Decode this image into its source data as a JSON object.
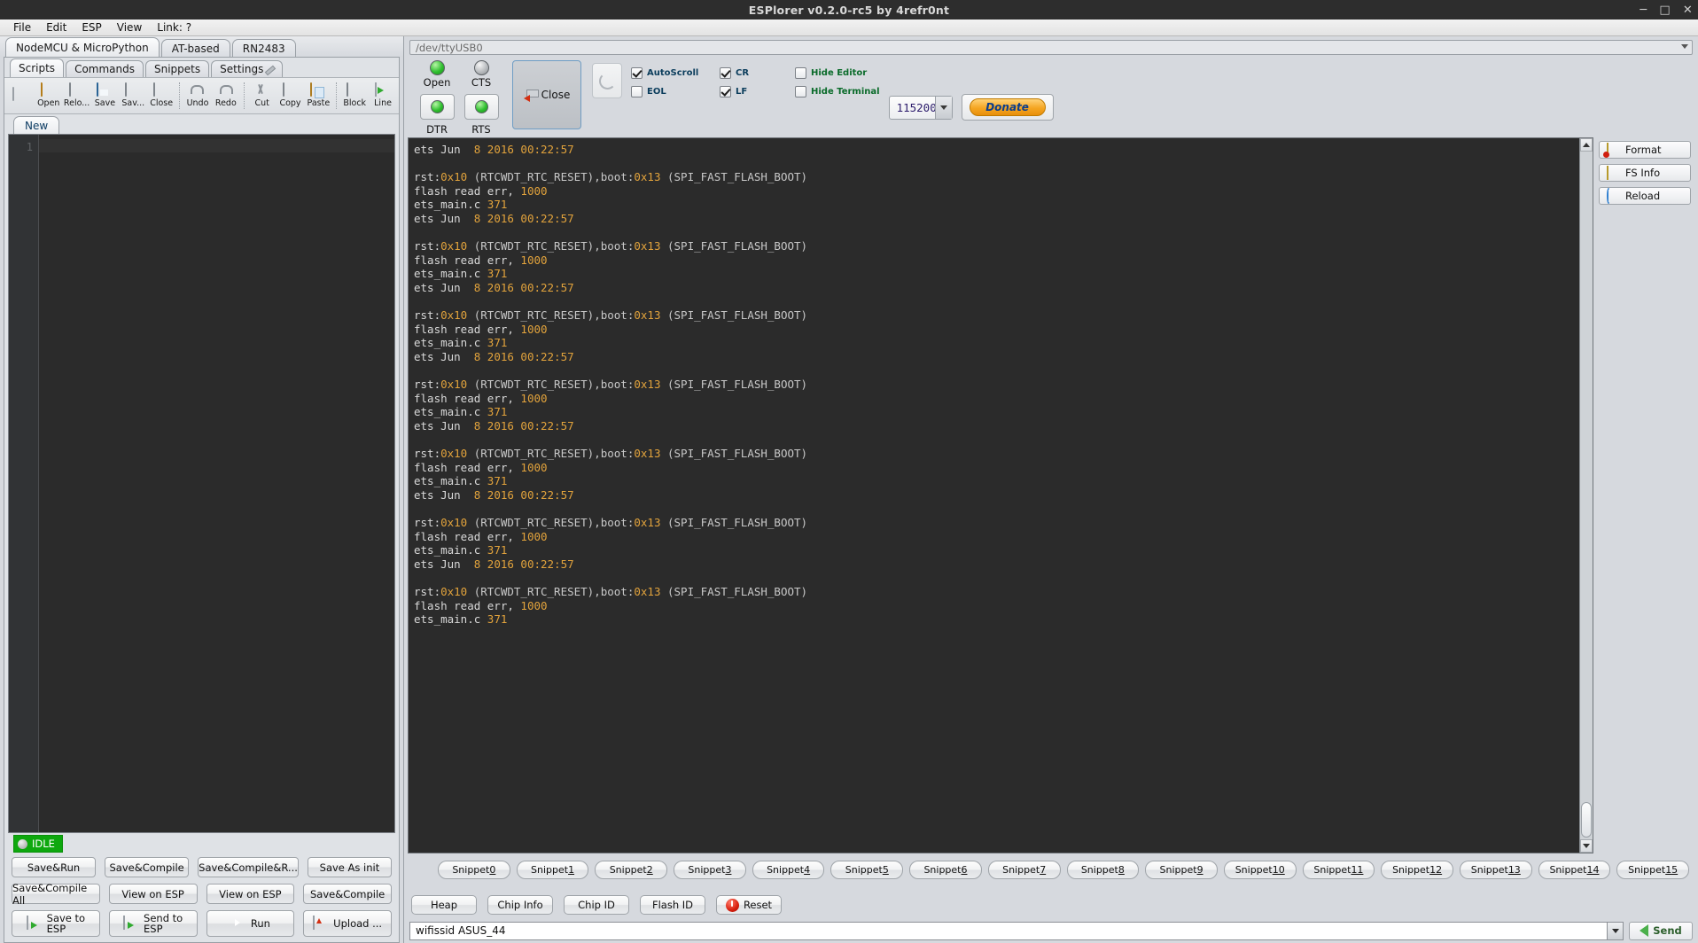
{
  "window": {
    "title": "ESPlorer v0.2.0-rc5 by 4refr0nt",
    "minimize": "─",
    "maximize": "□",
    "close": "✕"
  },
  "menubar": {
    "items": [
      "File",
      "Edit",
      "ESP",
      "View",
      "Link: ?"
    ]
  },
  "left": {
    "device_tabs": [
      {
        "label": "NodeMCU & MicroPython",
        "active": true
      },
      {
        "label": "AT-based",
        "active": false
      },
      {
        "label": "RN2483",
        "active": false
      }
    ],
    "mode_tabs": [
      {
        "label": "Scripts",
        "active": true
      },
      {
        "label": "Commands",
        "active": false
      },
      {
        "label": "Snippets",
        "active": false
      },
      {
        "label": "Settings",
        "active": false
      }
    ],
    "toolbar": [
      {
        "label": "",
        "icon": "new-file-icon"
      },
      {
        "label": "Open",
        "icon": "folder-open-icon"
      },
      {
        "label": "Relo...",
        "icon": "reload-icon"
      },
      {
        "label": "Save",
        "icon": "save-disk-icon"
      },
      {
        "label": "Sav...",
        "icon": "save-as-icon"
      },
      {
        "label": "Close",
        "icon": "close-file-icon"
      },
      {
        "label": "Undo",
        "icon": "undo-icon"
      },
      {
        "label": "Redo",
        "icon": "redo-icon"
      },
      {
        "label": "Cut",
        "icon": "scissors-icon"
      },
      {
        "label": "Copy",
        "icon": "copy-icon"
      },
      {
        "label": "Paste",
        "icon": "paste-icon"
      },
      {
        "label": "Block",
        "icon": "block-comment-icon"
      },
      {
        "label": "Line",
        "icon": "line-comment-icon"
      }
    ],
    "file_tab": "New",
    "editor": {
      "line_number": "1",
      "content": ""
    },
    "status": {
      "label": "IDLE",
      "color": "#0ea80e"
    },
    "buttons": {
      "row1": [
        "Save&Run",
        "Save&Compile",
        "Save&Compile&R...",
        "Save As init"
      ],
      "row2": [
        "Save&Compile All",
        "View on ESP",
        "View on ESP",
        "Save&Compile"
      ],
      "row3": [
        {
          "label": "Save to ESP",
          "line1": "Save to",
          "line2": "ESP",
          "icon": "save-to-esp-icon"
        },
        {
          "label": "Send to ESP",
          "line1": "Send to",
          "line2": "ESP",
          "icon": "send-to-esp-icon"
        },
        {
          "label": "Run",
          "line1": "Run",
          "line2": "",
          "icon": "run-icon"
        },
        {
          "label": "Upload ...",
          "line1": "Upload ...",
          "line2": "",
          "icon": "upload-icon"
        }
      ]
    }
  },
  "serial": {
    "port": "/dev/ttyUSB0",
    "leds": [
      {
        "label": "Open",
        "state": "green"
      },
      {
        "label": "CTS",
        "state": "grey"
      }
    ],
    "led_buttons": [
      {
        "label": "DTR",
        "state": "green"
      },
      {
        "label": "RTS",
        "state": "green"
      }
    ],
    "close_button": "Close",
    "refresh_icon": "refresh-icon",
    "checkboxes": [
      {
        "label": "AutoScroll",
        "checked": true
      },
      {
        "label": "EOL",
        "checked": false
      },
      {
        "label": "CR",
        "checked": true
      },
      {
        "label": "LF",
        "checked": true
      },
      {
        "label": "Hide Editor",
        "checked": false
      },
      {
        "label": "Hide Terminal",
        "checked": false
      }
    ],
    "baud": "115200",
    "donate": "Donate"
  },
  "terminal": {
    "lines": [
      [
        {
          "t": "ets Jun ",
          "c": "w"
        },
        {
          "t": " 8 2016 00:22:57",
          "c": "n"
        }
      ],
      [],
      [
        {
          "t": "rst:",
          "c": "w"
        },
        {
          "t": "0x10",
          "c": "n"
        },
        {
          "t": " (RTCWDT_RTC_RESET),boot:",
          "c": "p"
        },
        {
          "t": "0x13",
          "c": "n"
        },
        {
          "t": " (SPI_FAST_FLASH_BOOT)",
          "c": "p"
        }
      ],
      [
        {
          "t": "flash read err, ",
          "c": "w"
        },
        {
          "t": "1000",
          "c": "n"
        }
      ],
      [
        {
          "t": "ets_main.c ",
          "c": "w"
        },
        {
          "t": "371",
          "c": "n"
        }
      ],
      [
        {
          "t": "ets Jun ",
          "c": "w"
        },
        {
          "t": " 8 2016 00:22:57",
          "c": "n"
        }
      ],
      [],
      [
        {
          "t": "rst:",
          "c": "w"
        },
        {
          "t": "0x10",
          "c": "n"
        },
        {
          "t": " (RTCWDT_RTC_RESET),boot:",
          "c": "p"
        },
        {
          "t": "0x13",
          "c": "n"
        },
        {
          "t": " (SPI_FAST_FLASH_BOOT)",
          "c": "p"
        }
      ],
      [
        {
          "t": "flash read err, ",
          "c": "w"
        },
        {
          "t": "1000",
          "c": "n"
        }
      ],
      [
        {
          "t": "ets_main.c ",
          "c": "w"
        },
        {
          "t": "371",
          "c": "n"
        }
      ],
      [
        {
          "t": "ets Jun ",
          "c": "w"
        },
        {
          "t": " 8 2016 00:22:57",
          "c": "n"
        }
      ],
      [],
      [
        {
          "t": "rst:",
          "c": "w"
        },
        {
          "t": "0x10",
          "c": "n"
        },
        {
          "t": " (RTCWDT_RTC_RESET),boot:",
          "c": "p"
        },
        {
          "t": "0x13",
          "c": "n"
        },
        {
          "t": " (SPI_FAST_FLASH_BOOT)",
          "c": "p"
        }
      ],
      [
        {
          "t": "flash read err, ",
          "c": "w"
        },
        {
          "t": "1000",
          "c": "n"
        }
      ],
      [
        {
          "t": "ets_main.c ",
          "c": "w"
        },
        {
          "t": "371",
          "c": "n"
        }
      ],
      [
        {
          "t": "ets Jun ",
          "c": "w"
        },
        {
          "t": " 8 2016 00:22:57",
          "c": "n"
        }
      ],
      [],
      [
        {
          "t": "rst:",
          "c": "w"
        },
        {
          "t": "0x10",
          "c": "n"
        },
        {
          "t": " (RTCWDT_RTC_RESET),boot:",
          "c": "p"
        },
        {
          "t": "0x13",
          "c": "n"
        },
        {
          "t": " (SPI_FAST_FLASH_BOOT)",
          "c": "p"
        }
      ],
      [
        {
          "t": "flash read err, ",
          "c": "w"
        },
        {
          "t": "1000",
          "c": "n"
        }
      ],
      [
        {
          "t": "ets_main.c ",
          "c": "w"
        },
        {
          "t": "371",
          "c": "n"
        }
      ],
      [
        {
          "t": "ets Jun ",
          "c": "w"
        },
        {
          "t": " 8 2016 00:22:57",
          "c": "n"
        }
      ],
      [],
      [
        {
          "t": "rst:",
          "c": "w"
        },
        {
          "t": "0x10",
          "c": "n"
        },
        {
          "t": " (RTCWDT_RTC_RESET),boot:",
          "c": "p"
        },
        {
          "t": "0x13",
          "c": "n"
        },
        {
          "t": " (SPI_FAST_FLASH_BOOT)",
          "c": "p"
        }
      ],
      [
        {
          "t": "flash read err, ",
          "c": "w"
        },
        {
          "t": "1000",
          "c": "n"
        }
      ],
      [
        {
          "t": "ets_main.c ",
          "c": "w"
        },
        {
          "t": "371",
          "c": "n"
        }
      ],
      [
        {
          "t": "ets Jun ",
          "c": "w"
        },
        {
          "t": " 8 2016 00:22:57",
          "c": "n"
        }
      ],
      [],
      [
        {
          "t": "rst:",
          "c": "w"
        },
        {
          "t": "0x10",
          "c": "n"
        },
        {
          "t": " (RTCWDT_RTC_RESET),boot:",
          "c": "p"
        },
        {
          "t": "0x13",
          "c": "n"
        },
        {
          "t": " (SPI_FAST_FLASH_BOOT)",
          "c": "p"
        }
      ],
      [
        {
          "t": "flash read err, ",
          "c": "w"
        },
        {
          "t": "1000",
          "c": "n"
        }
      ],
      [
        {
          "t": "ets_main.c ",
          "c": "w"
        },
        {
          "t": "371",
          "c": "n"
        }
      ],
      [
        {
          "t": "ets Jun ",
          "c": "w"
        },
        {
          "t": " 8 2016 00:22:57",
          "c": "n"
        }
      ],
      [],
      [
        {
          "t": "rst:",
          "c": "w"
        },
        {
          "t": "0x10",
          "c": "n"
        },
        {
          "t": " (RTCWDT_RTC_RESET),boot:",
          "c": "p"
        },
        {
          "t": "0x13",
          "c": "n"
        },
        {
          "t": " (SPI_FAST_FLASH_BOOT)",
          "c": "p"
        }
      ],
      [
        {
          "t": "flash read err, ",
          "c": "w"
        },
        {
          "t": "1000",
          "c": "n"
        }
      ],
      [
        {
          "t": "ets_main.c ",
          "c": "w"
        },
        {
          "t": "371",
          "c": "n"
        }
      ]
    ]
  },
  "right_buttons": [
    {
      "label": "Format",
      "icon": "format-icon"
    },
    {
      "label": "FS Info",
      "icon": "fs-info-icon"
    },
    {
      "label": "Reload",
      "icon": "reload-icon"
    }
  ],
  "snippets": [
    "Snippet0",
    "Snippet1",
    "Snippet2",
    "Snippet3",
    "Snippet4",
    "Snippet5",
    "Snippet6",
    "Snippet7",
    "Snippet8",
    "Snippet9",
    "Snippet10",
    "Snippet11",
    "Snippet12",
    "Snippet13",
    "Snippet14",
    "Snippet15"
  ],
  "esp_info_buttons": [
    {
      "label": "Heap",
      "icon": ""
    },
    {
      "label": "Chip Info",
      "icon": ""
    },
    {
      "label": "Chip ID",
      "icon": ""
    },
    {
      "label": "Flash ID",
      "icon": ""
    },
    {
      "label": "Reset",
      "icon": "power-icon"
    }
  ],
  "command_bar": {
    "value": "wifissid ASUS_44",
    "placeholder": "",
    "send_label": "Send",
    "send_icon": "green-left-arrow-icon"
  }
}
